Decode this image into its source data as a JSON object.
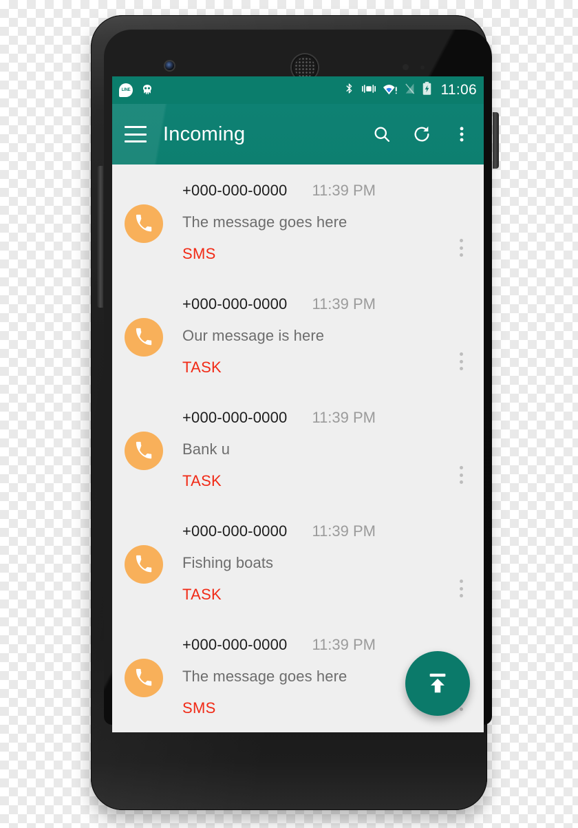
{
  "device": {
    "name": "android-phone-mockup",
    "camera_icon": "front-camera",
    "speaker_icon": "earpiece-speaker",
    "power_button": "power-button",
    "volume_button": "volume-rocker"
  },
  "status_bar": {
    "left_icons": [
      {
        "name": "line-app-icon",
        "label": "LINE"
      },
      {
        "name": "cyanogenmod-icon",
        "label": ""
      }
    ],
    "right_icons": [
      {
        "name": "bluetooth-icon"
      },
      {
        "name": "vibrate-icon"
      },
      {
        "name": "wifi-alert-icon"
      },
      {
        "name": "signal-off-icon"
      },
      {
        "name": "battery-charging-icon"
      }
    ],
    "time": "11:06"
  },
  "toolbar": {
    "menu_icon": "hamburger-menu-icon",
    "title": "Incoming",
    "actions": [
      {
        "name": "search-icon",
        "label": "Search"
      },
      {
        "name": "refresh-icon",
        "label": "Refresh"
      },
      {
        "name": "overflow-menu-icon",
        "label": "More options"
      }
    ],
    "background_color": "#0d7f70"
  },
  "list": {
    "rows": [
      {
        "number": "+000-000-0000",
        "time": "11:39 PM",
        "message": "The message goes here",
        "tag": "SMS"
      },
      {
        "number": "+000-000-0000",
        "time": "11:39 PM",
        "message": "Our message is here",
        "tag": "TASK"
      },
      {
        "number": "+000-000-0000",
        "time": "11:39 PM",
        "message": "Bank u",
        "tag": "TASK"
      },
      {
        "number": "+000-000-0000",
        "time": "11:39 PM",
        "message": "Fishing boats",
        "tag": "TASK"
      },
      {
        "number": "+000-000-0000",
        "time": "11:39 PM",
        "message": "The message goes here",
        "tag": "SMS"
      }
    ],
    "avatar_icon": "phone-handset-icon",
    "row_menu_icon": "row-overflow-icon",
    "avatar_color": "#f8b05a",
    "tag_color": "#f12a16",
    "background_color": "#efefef"
  },
  "fab": {
    "name": "upload-fab",
    "icon": "upload-arrow-icon",
    "color": "#0b7a6a"
  }
}
